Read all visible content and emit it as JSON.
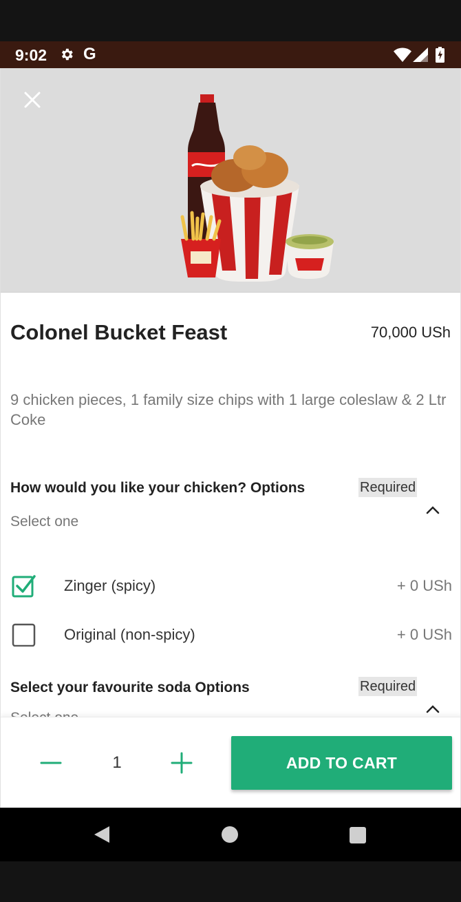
{
  "status_bar": {
    "time": "9:02",
    "g_label": "G",
    "icons": [
      "gear-icon",
      "google-icon",
      "wifi-icon",
      "signal-icon",
      "battery-charging-icon"
    ]
  },
  "product": {
    "title": "Colonel Bucket Feast",
    "price": "70,000 USh",
    "description": "9 chicken pieces, 1 family size chips with 1 large coleslaw & 2 Ltr Coke"
  },
  "option_groups": [
    {
      "title": "How would you like your chicken? Options",
      "badge": "Required",
      "subtitle": "Select one",
      "options": [
        {
          "label": "Zinger (spicy)",
          "price": "+ 0 USh",
          "checked": true
        },
        {
          "label": "Original (non-spicy)",
          "price": "+ 0 USh",
          "checked": false
        }
      ]
    },
    {
      "title": "Select your favourite soda Options",
      "badge": "Required",
      "subtitle": "Select one"
    }
  ],
  "cart": {
    "quantity": "1",
    "add_label": "ADD TO CART"
  },
  "colors": {
    "accent": "#20ad78",
    "status_bar": "#3a1a10",
    "required_badge": "#e6e6e6"
  }
}
